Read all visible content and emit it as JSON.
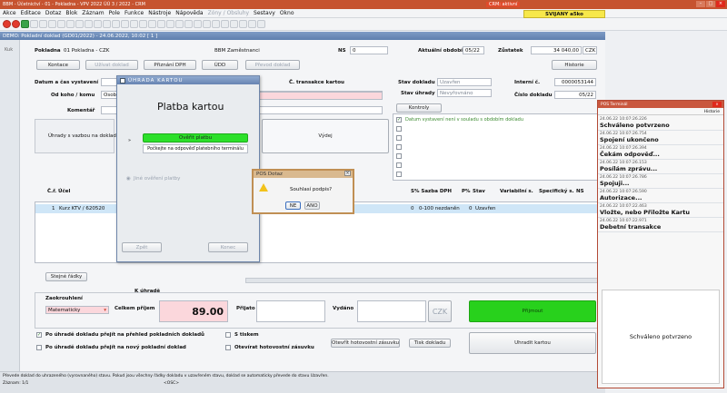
{
  "app": {
    "title_bar": "BBM - Účetnictví - 01 - Pokladna - VPV 2022 ÚÚ 3 / 2022 - CRM",
    "title_warning": "CRM: aktivní",
    "brand": "SVIJANY a5ko",
    "menu": [
      "Akce",
      "Editace",
      "Dotaz",
      "Blok",
      "Záznam",
      "Pole",
      "Funkce",
      "Nástroje",
      "Nápověda",
      "Sestavy",
      "Okno"
    ],
    "menu_dim": "Zóny / Obsluhy"
  },
  "form": {
    "title": "DEMO: Pokladní doklad (GD01/2022) - 24.06.2022, 10:02 [ 1 ]",
    "left_rail": "Kuk",
    "pokladna_label": "Pokladna",
    "pokladna_value": "01 Pokladna - CZK",
    "zamestnanci": "BBM Zaměstnanci",
    "ns_label": "NS",
    "ns_value": "0",
    "aktualni_obdobi_label": "Aktuální období",
    "aktualni_obdobi_value": "05/22",
    "zustatek_label": "Zůstatek",
    "zustatek_value": "34 040,00",
    "currency": "CZK",
    "buttons": {
      "kontace": "Kontace",
      "uzivat_doklad": "Užívat doklad",
      "prizani_dph": "Přiznání DPH",
      "udd": "ÚDD",
      "prevod_doklad": "Převod doklad",
      "historie": "Historie",
      "kontroly": "Kontroly",
      "vydej": "Výdej",
      "stejne_radky": "Stejné řádky",
      "otevrit_zasuvku": "Otevřít hotovostní zásuvku",
      "tisk_dokladu": "Tisk dokladu",
      "prijmout": "Přijmout",
      "uhradit_kartou": "Uhradit kartou",
      "czk": "CZK"
    },
    "datum_label": "Datum a čas vystavení",
    "od_koho_label": "Od koho / komu",
    "od_koho_value": "Osob",
    "komentar_label": "Komentář",
    "transakce_label": "Č. transakce kartou",
    "stav_dokladu_label": "Stav dokladu",
    "stav_dokladu_value": "Uzavřen",
    "stav_uhrady_label": "Stav úhrady",
    "stav_uhrady_value": "Nevyřovnáno",
    "interni_label": "Interní č.",
    "interni_value": "0000053144",
    "cislo_dokladu_label": "Číslo dokladu",
    "cislo_dokladu_value": "05/22",
    "uhrady_label": "Úhrady s vazbou na doklad",
    "kontroly_msg": "Datum vystavení není v souladu s obdobím dokladu",
    "table": {
      "headers": [
        "Č.ř.",
        "Účel",
        "S% Sazba DPH",
        "P%",
        "Stav",
        "Variabilní s.",
        "Specifický s.",
        "NS"
      ],
      "row": {
        "num": "1",
        "ucel": "Kurz KTV / 620520",
        "s": "0",
        "sazba": "0-100 nezdaněn",
        "p": "0",
        "stav": "Uzavřen"
      }
    },
    "k_uhrade_label": "K úhradě",
    "zaokrouhleni_label": "Zaokrouhlení",
    "zaokrouhleni_value": "Matematicky",
    "celkem_label": "Celkem příjem",
    "celkem_value": "89.00",
    "prijato_label": "Přijato",
    "vydano_label": "Vydáno",
    "options": [
      "Po úhradě dokladu přejít na přehled pokladních dokladů",
      "Po úhradě dokladu přejít na nový pokladní doklad",
      "S tiskem",
      "Otevírat hotovostní zásuvku"
    ],
    "status_line1": "Převede doklad do uhrazeného (vyrovnaného) stavu. Pokud jsou všechny řádky dokladu v uzavřeném stavu, doklad se automaticky převede do stavu Uzavřen.",
    "status_line2": "Záznam: 1/1",
    "status_osc": "<OSC>"
  },
  "card_dialog": {
    "title": "ÚHRADA KARTOU",
    "heading": "Platba kartou",
    "step_button": "Ověřit platbu",
    "message": "Počkejte na odpověď platebního terminálu",
    "radio_label": "Jiné ověření platby",
    "back_button": "Zpět",
    "end_button": "Konec"
  },
  "pos_dialog": {
    "title": "POS Dotaz",
    "question": "Souhlasí podpis?",
    "no": "NE",
    "yes": "ANO"
  },
  "terminal": {
    "title": "POS Terminál",
    "history": "Historie",
    "log": [
      {
        "time": "24.06.22 10:07:26.226",
        "text": "Schváleno potvrzeno"
      },
      {
        "time": "24.06.22 10:07:26.754",
        "text": "Spojení ukončeno"
      },
      {
        "time": "24.06.22 10:07:26.394",
        "text": "Čekám odpověď..."
      },
      {
        "time": "24.06.22 10:07:26.153",
        "text": "Posílám zprávu..."
      },
      {
        "time": "24.06.22 10:07:26.786",
        "text": "Spojuji..."
      },
      {
        "time": "24.06.22 10:07:26.590",
        "text": "Autorizace..."
      },
      {
        "time": "24.06.22 10:07:22.463",
        "text": "Vložte, nebo Přiložte Kartu"
      },
      {
        "time": "24.06.22 10:07:22.971",
        "text": "Debetní transakce"
      }
    ],
    "status": "Schváleno potvrzeno"
  }
}
